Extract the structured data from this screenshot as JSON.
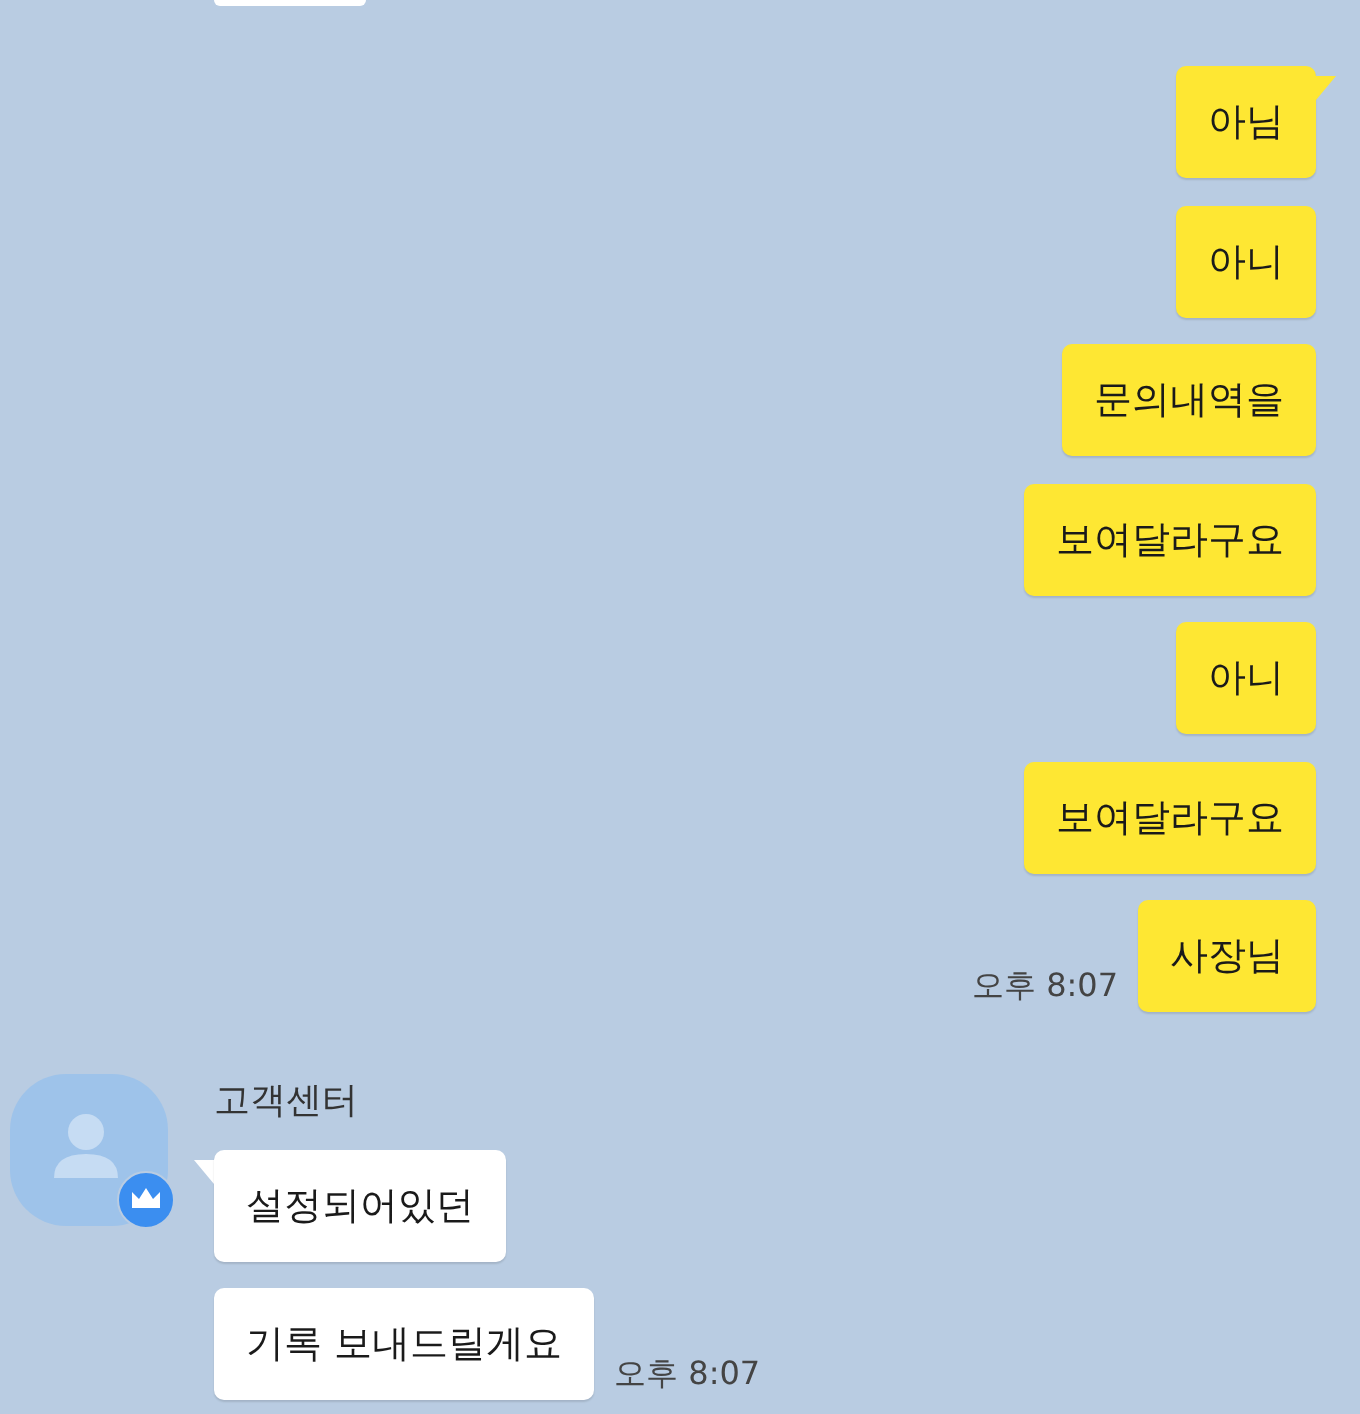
{
  "sent_messages": [
    {
      "text": "아님",
      "tail": true
    },
    {
      "text": "아니",
      "tail": false
    },
    {
      "text": "문의내역을",
      "tail": false
    },
    {
      "text": "보여달라구요",
      "tail": false
    },
    {
      "text": "아니",
      "tail": false
    },
    {
      "text": "보여달라구요",
      "tail": false
    },
    {
      "text": "사장님",
      "tail": false,
      "time": "오후 8:07"
    }
  ],
  "received": {
    "sender": "고객센터",
    "badge": true,
    "messages": [
      {
        "text": "설정되어있던",
        "tail": true
      },
      {
        "text": "기록 보내드릴게요",
        "tail": false,
        "time": "오후 8:07"
      }
    ]
  }
}
